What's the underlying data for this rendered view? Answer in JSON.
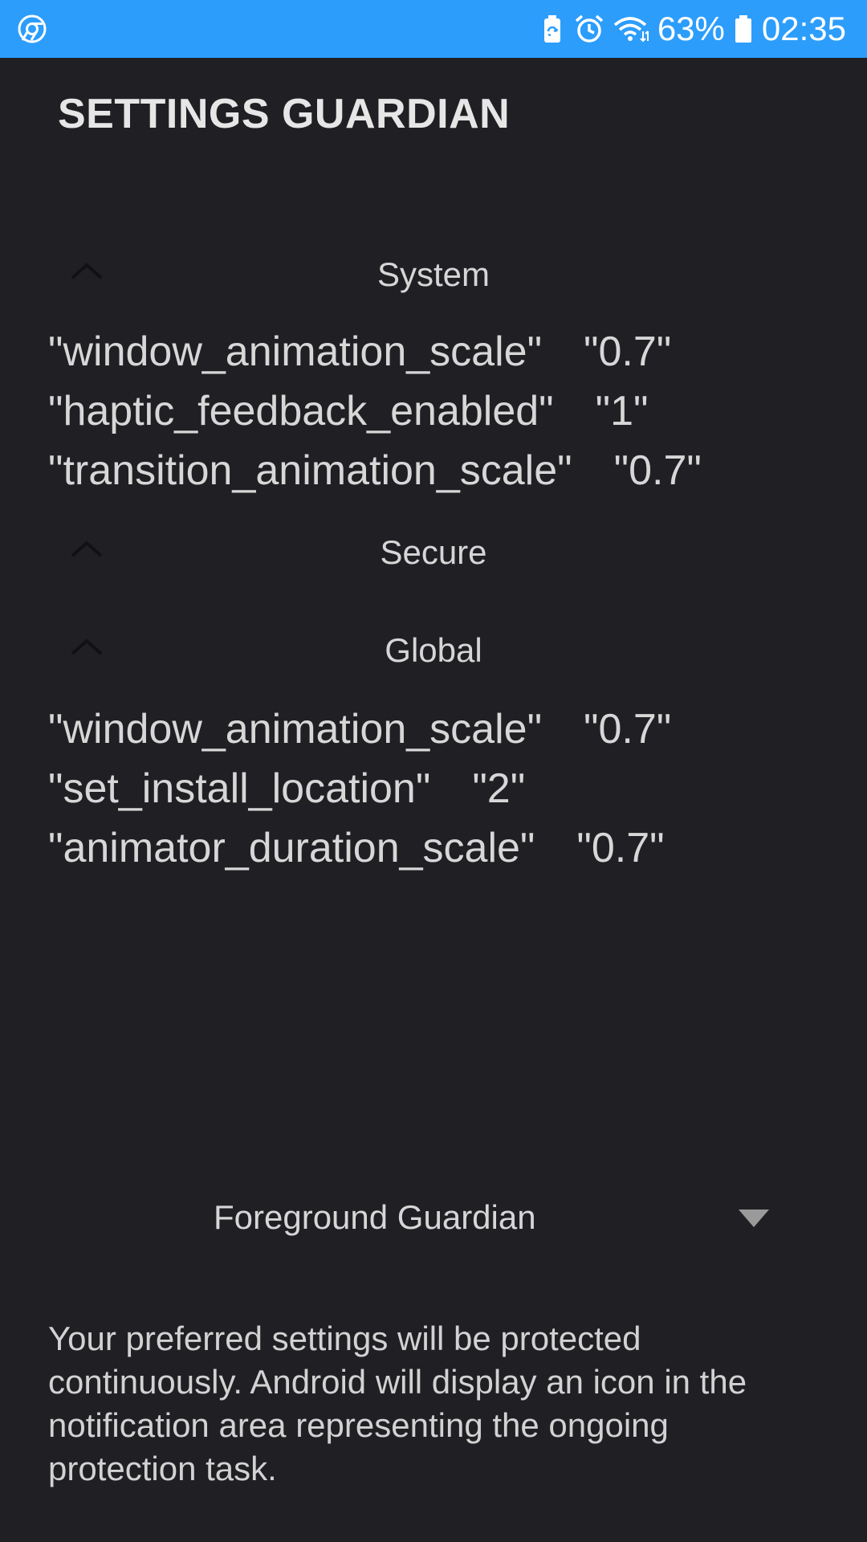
{
  "status_bar": {
    "battery_percent": "63%",
    "time": "02:35",
    "bg_color": "#2c9dfb",
    "icons": [
      "chrome-icon",
      "battery-saver-icon",
      "alarm-icon",
      "wifi-icon",
      "battery-icon"
    ]
  },
  "app": {
    "title": "SETTINGS GUARDIAN"
  },
  "sections": {
    "system": {
      "title": "System",
      "rows": [
        {
          "key": "\"window_animation_scale\"",
          "value": "\"0.7\""
        },
        {
          "key": "\"haptic_feedback_enabled\"",
          "value": "\"1\""
        },
        {
          "key": "\"transition_animation_scale\"",
          "value": "\"0.7\""
        }
      ]
    },
    "secure": {
      "title": "Secure",
      "rows": []
    },
    "global": {
      "title": "Global",
      "rows": [
        {
          "key": "\"window_animation_scale\"",
          "value": "\"0.7\""
        },
        {
          "key": "\"set_install_location\"",
          "value": "\"2\""
        },
        {
          "key": "\"animator_duration_scale\"",
          "value": "\"0.7\""
        }
      ]
    }
  },
  "foreground": {
    "label": "Foreground Guardian",
    "description": "Your preferred settings will be protected continuously. Android will display an icon in the notification area representing the ongoing protection task."
  },
  "colors": {
    "background": "#202024",
    "text": "#d7d7d7",
    "chevron": "#111114"
  }
}
